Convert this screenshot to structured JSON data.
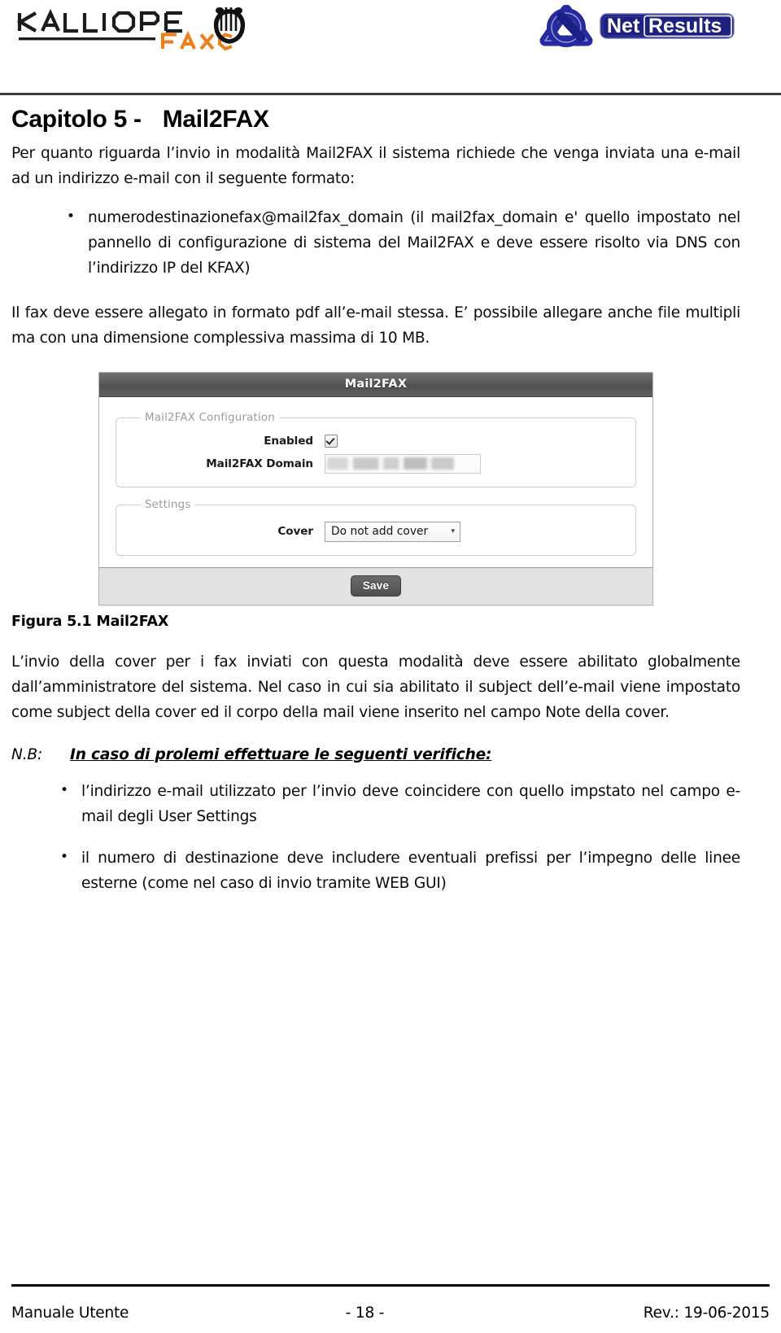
{
  "header": {
    "brand_left": {
      "name": "KALLIOPE",
      "subname": "FAX",
      "icon": "lyre-icon",
      "colors": {
        "text": "#1a1a1a",
        "accent": "#ef7d1a"
      }
    },
    "brand_right": {
      "name_part1": "Net",
      "name_part2": "Results",
      "icon": "trefoil-knot-icon",
      "colors": {
        "dark_blue": "#1a1f8c",
        "mid_blue": "#2a2fa8",
        "box": "#1c1f7a"
      }
    }
  },
  "document": {
    "chapter_title_prefix": "Capitolo 5 -",
    "chapter_title_name": "Mail2FAX",
    "intro_paragraph": "Per quanto riguarda l’invio in modalità Mail2FAX il sistema richiede che venga inviata una e-mail ad un indirizzo e-mail con il seguente formato:",
    "format_bullets": [
      "numerodestinazionefax@mail2fax_domain (il mail2fax_domain e' quello impostato nel pannello di configurazione di sistema del Mail2FAX e deve essere risolto via DNS con l’indirizzo IP del KFAX)"
    ],
    "attachment_paragraph": "Il fax deve essere allegato in formato pdf all’e-mail stessa. E’ possibile allegare anche file multipli ma con una dimensione complessiva massima di 10 MB.",
    "figure_caption": "Figura 5.1 Mail2FAX",
    "cover_paragraph": "L’invio della cover per i fax inviati con questa modalità deve essere abilitato globalmente dall’amministratore del sistema. Nel caso in cui sia abilitato il subject dell’e-mail viene impostato come subject della cover ed il corpo della mail viene inserito nel campo Note della cover.",
    "nb_label": "N.B:",
    "nb_heading": "In caso di prolemi effettuare le seguenti verifiche:",
    "nb_bullets": [
      "l’indirizzo e-mail utilizzato per l’invio deve coincidere con quello impstato nel campo e-mail degli User Settings",
      "il numero di destinazione deve includere eventuali prefissi per l’impegno delle linee esterne (come nel caso di invio tramite WEB GUI)"
    ]
  },
  "figure": {
    "window_title": "Mail2FAX",
    "groups": [
      {
        "legend": "Mail2FAX Configuration",
        "rows": [
          {
            "label": "Enabled",
            "type": "checkbox",
            "checked": true
          },
          {
            "label": "Mail2FAX Domain",
            "type": "text",
            "value": "",
            "redacted": true
          }
        ]
      },
      {
        "legend": "Settings",
        "rows": [
          {
            "label": "Cover",
            "type": "select",
            "value": "Do not add cover",
            "caret": "▾"
          }
        ]
      }
    ],
    "save_label": "Save"
  },
  "footer": {
    "left": "Manuale Utente",
    "center": "- 18 -",
    "right": "Rev.: 19-06-2015"
  }
}
